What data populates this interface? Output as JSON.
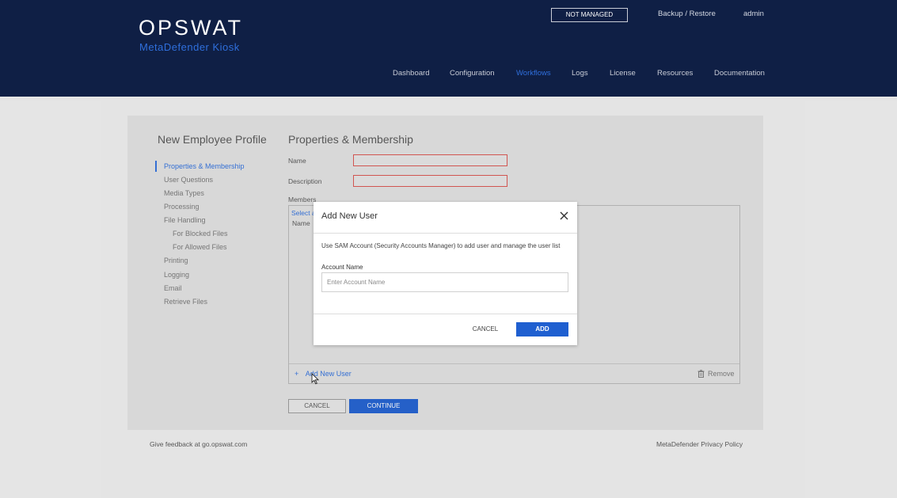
{
  "brand": {
    "logo": "OPSWAT",
    "product": "MetaDefender Kiosk"
  },
  "top_bar": {
    "status_badge": "NOT MANAGED",
    "backup_restore": "Backup / Restore",
    "user": "admin"
  },
  "nav": {
    "items": [
      {
        "label": "Dashboard"
      },
      {
        "label": "Configuration"
      },
      {
        "label": "Workflows",
        "active": true
      },
      {
        "label": "Logs"
      },
      {
        "label": "License"
      },
      {
        "label": "Resources"
      },
      {
        "label": "Documentation"
      }
    ]
  },
  "sidebar": {
    "title": "New Employee Profile",
    "items": [
      {
        "label": "Properties & Membership",
        "active": true
      },
      {
        "label": "User Questions"
      },
      {
        "label": "Media Types"
      },
      {
        "label": "Processing"
      },
      {
        "label": "File Handling"
      },
      {
        "label": "For Blocked Files",
        "sub": true
      },
      {
        "label": "For Allowed Files",
        "sub": true
      },
      {
        "label": "Printing"
      },
      {
        "label": "Logging"
      },
      {
        "label": "Email"
      },
      {
        "label": "Retrieve Files"
      }
    ]
  },
  "main": {
    "title": "Properties & Membership",
    "name_label": "Name",
    "description_label": "Description",
    "members_label": "Members",
    "select_label": "Select a",
    "name_column": "Name",
    "add_new_user": "Add New User",
    "add_prefix": "+",
    "remove": "Remove",
    "cancel": "CANCEL",
    "continue": "CONTINUE"
  },
  "footer": {
    "feedback": "Give feedback at go.opswat.com",
    "privacy": "MetaDefender Privacy Policy"
  },
  "modal": {
    "title": "Add New User",
    "description": "Use SAM Account (Security Accounts Manager) to add user and manage the user list",
    "account_label": "Account Name",
    "account_placeholder": "Enter Account Name",
    "cancel": "CANCEL",
    "add": "ADD"
  },
  "colors": {
    "header_bg": "#0f1f45",
    "accent": "#1f5fd0",
    "error_border": "#d9534f"
  }
}
